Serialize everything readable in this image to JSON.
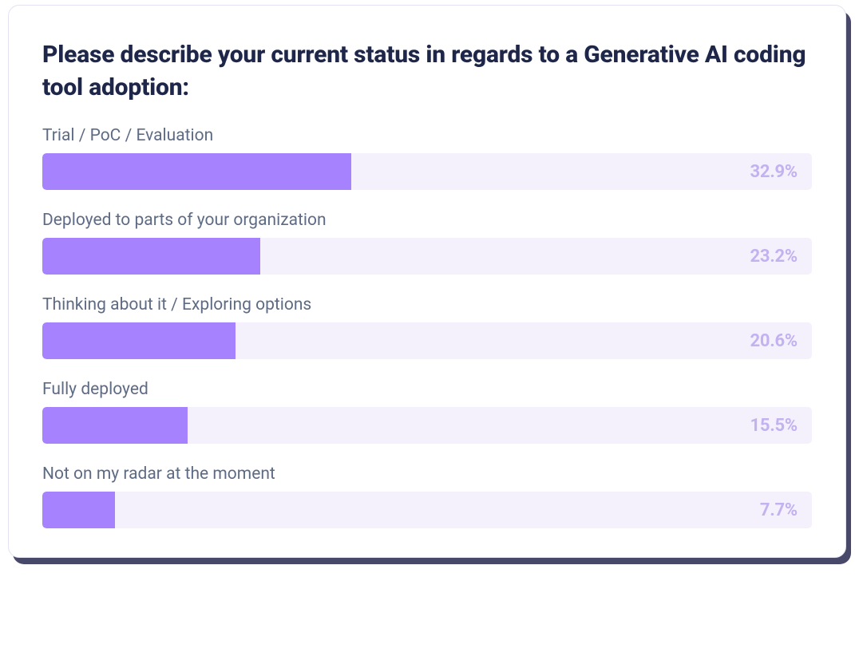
{
  "title": "Please describe your current status in regards to a Generative AI coding tool adoption:",
  "chart_data": {
    "type": "bar",
    "title": "Please describe your current status in regards to a Generative AI coding tool adoption:",
    "categories": [
      "Trial / PoC / Evaluation",
      "Deployed to parts of your organization",
      "Thinking about it / Exploring options",
      "Fully deployed",
      "Not on my radar at the moment"
    ],
    "values": [
      32.9,
      23.2,
      20.6,
      15.5,
      7.7
    ],
    "value_labels": [
      "32.9%",
      "23.2%",
      "20.6%",
      "15.5%",
      "7.7%"
    ],
    "xlabel": "",
    "ylabel": "",
    "ylim": [
      0,
      100
    ]
  },
  "bars": [
    {
      "label": "Trial / PoC / Evaluation",
      "value": 32.9,
      "value_label": "32.9%"
    },
    {
      "label": "Deployed to parts of your organization",
      "value": 23.2,
      "value_label": "23.2%"
    },
    {
      "label": "Thinking about it / Exploring options",
      "value": 20.6,
      "value_label": "20.6%"
    },
    {
      "label": "Fully deployed",
      "value": 15.5,
      "value_label": "15.5%"
    },
    {
      "label": "Not on my radar at the moment",
      "value": 7.7,
      "value_label": "7.7%"
    }
  ]
}
